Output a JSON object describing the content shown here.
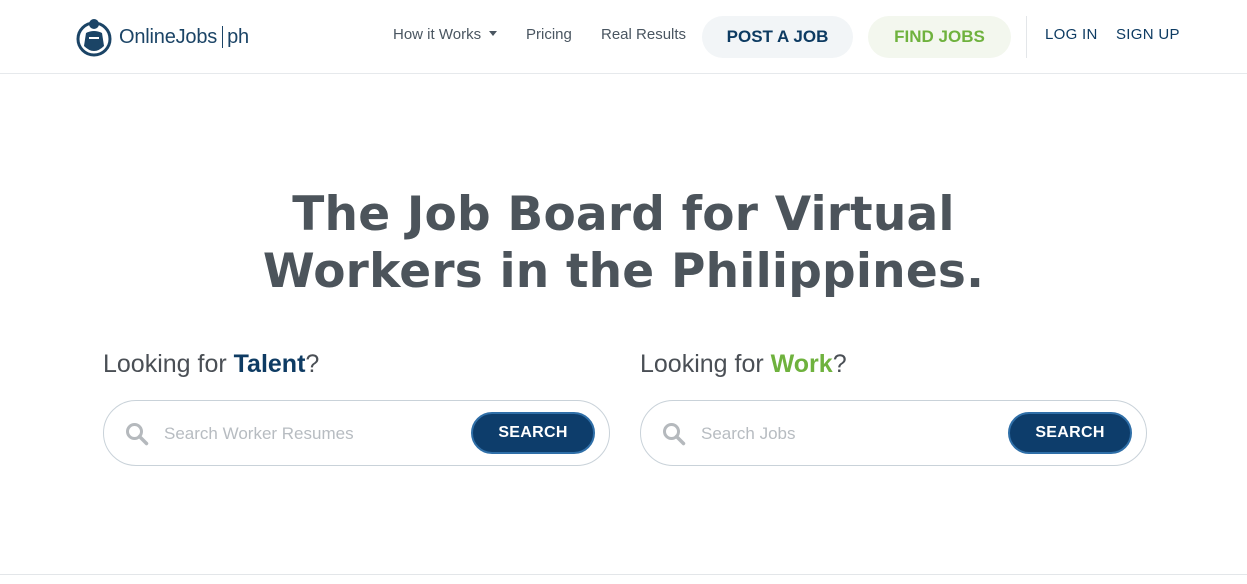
{
  "header": {
    "logo": {
      "name": "OnlineJobs",
      "suffix": "ph"
    },
    "nav": {
      "how_it_works": "How it Works",
      "pricing": "Pricing",
      "real_results": "Real Results"
    },
    "post_job": "POST A JOB",
    "find_jobs": "FIND JOBS",
    "login": "LOG IN",
    "signup": "SIGN UP"
  },
  "hero": {
    "headline_line1": "The Job Board for Virtual",
    "headline_line2": "Workers in the Philippines."
  },
  "talent": {
    "prefix": "Looking for ",
    "highlight": "Talent",
    "suffix": "?",
    "placeholder": "Search Worker Resumes",
    "button": "SEARCH"
  },
  "work": {
    "prefix": "Looking for ",
    "highlight": "Work",
    "suffix": "?",
    "placeholder": "Search Jobs",
    "button": "SEARCH"
  },
  "icons": {
    "logo": "person-carrying-icon",
    "search": "magnifier-icon",
    "dropdown": "caret-down-icon"
  },
  "colors": {
    "brand_navy": "#0d3b62",
    "brand_green": "#6fb23e",
    "button_blue": "#0d3d6b"
  }
}
